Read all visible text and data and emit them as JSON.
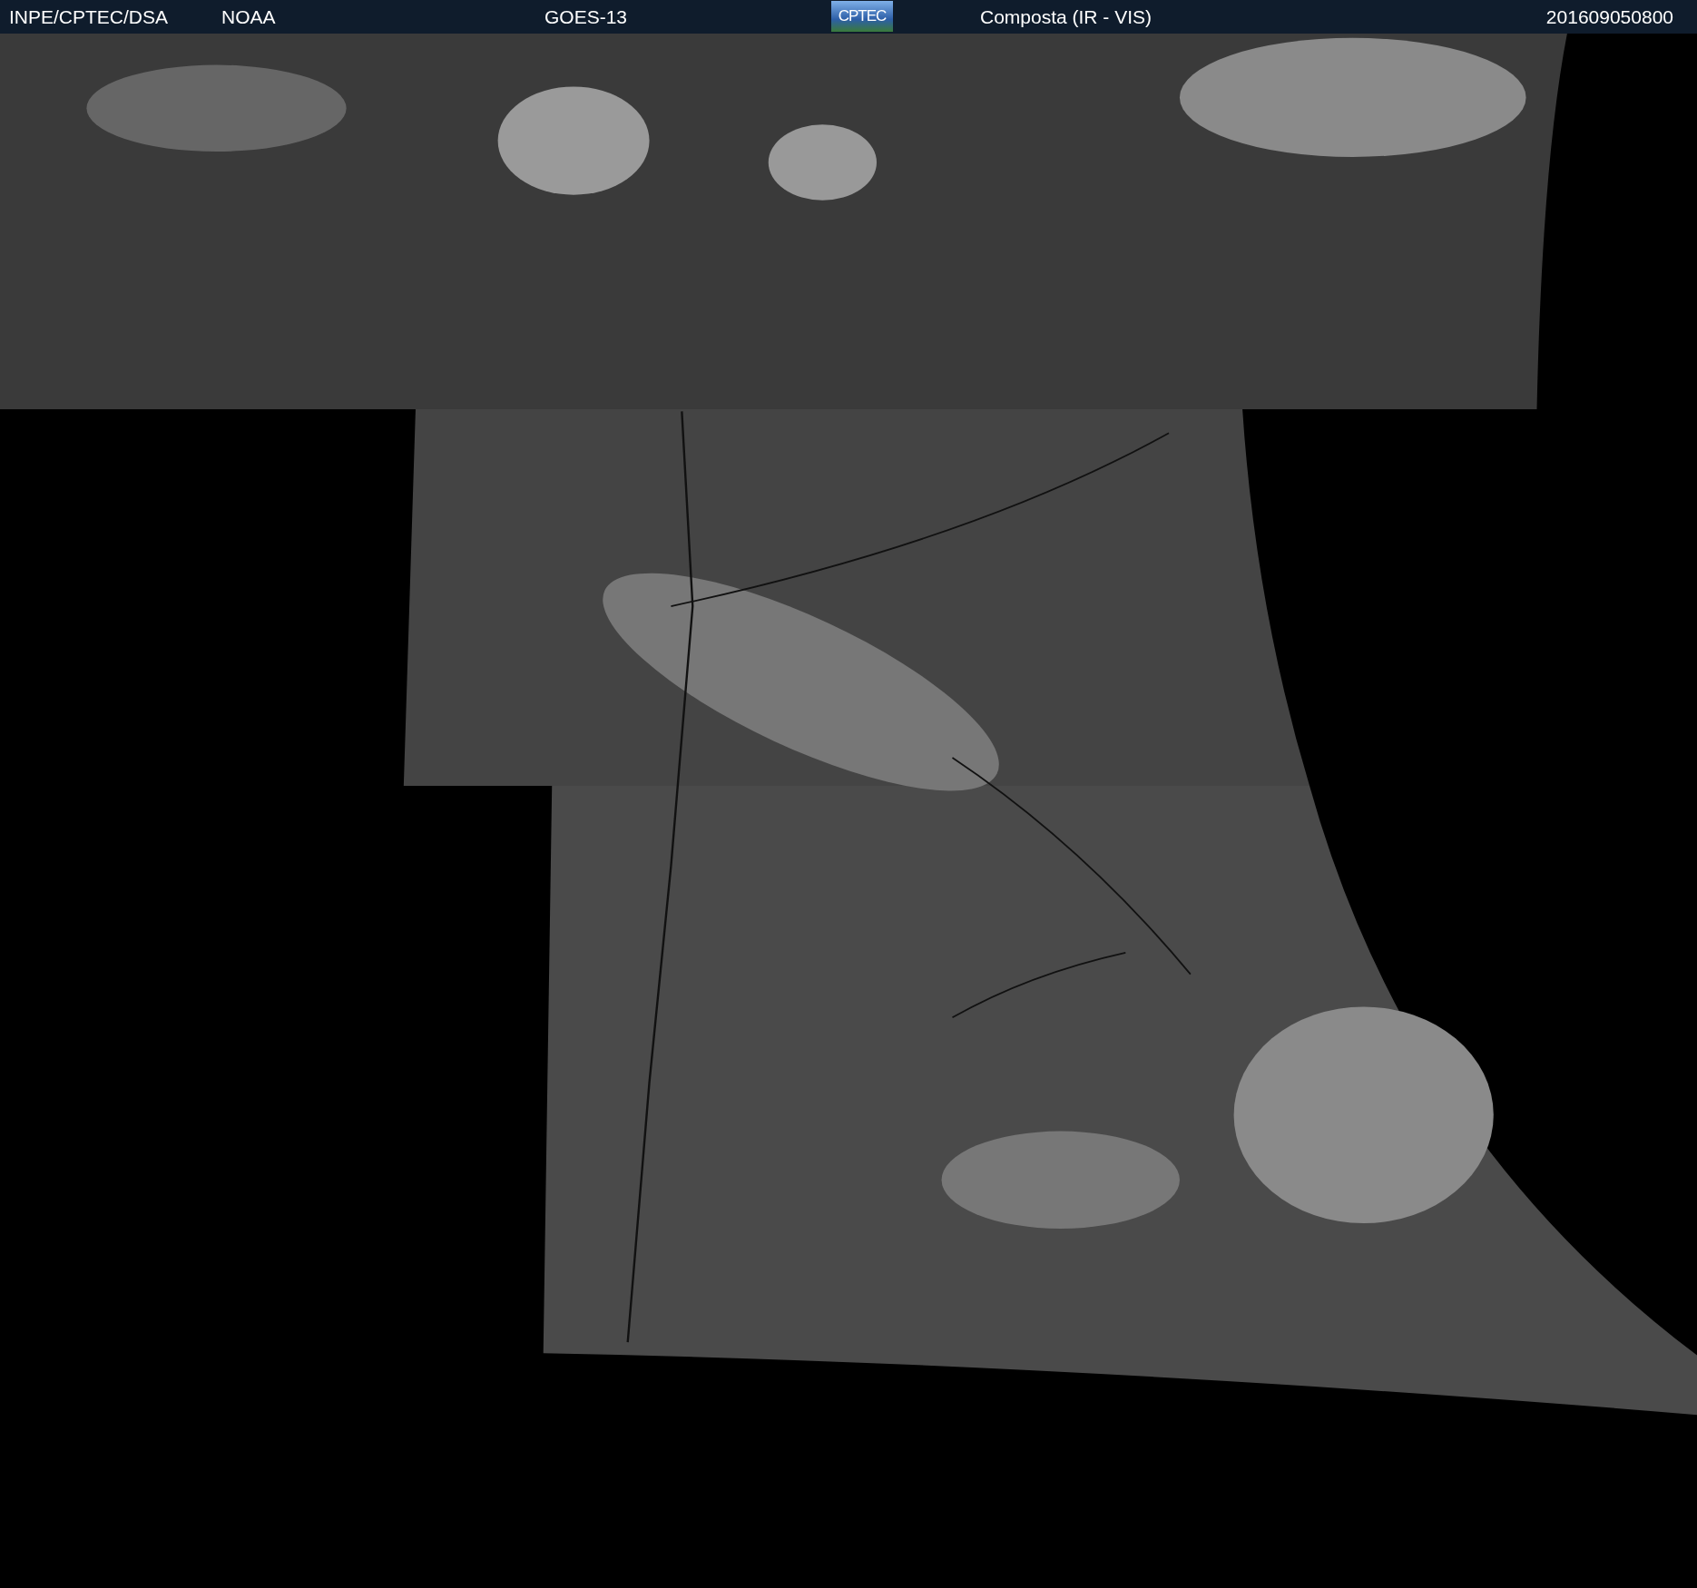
{
  "header": {
    "source": "INPE/CPTEC/DSA",
    "agency": "NOAA",
    "satellite": "GOES-13",
    "logo": "CPTEC",
    "product": "Composta (IR - VIS)",
    "timestamp": "201609050800"
  }
}
